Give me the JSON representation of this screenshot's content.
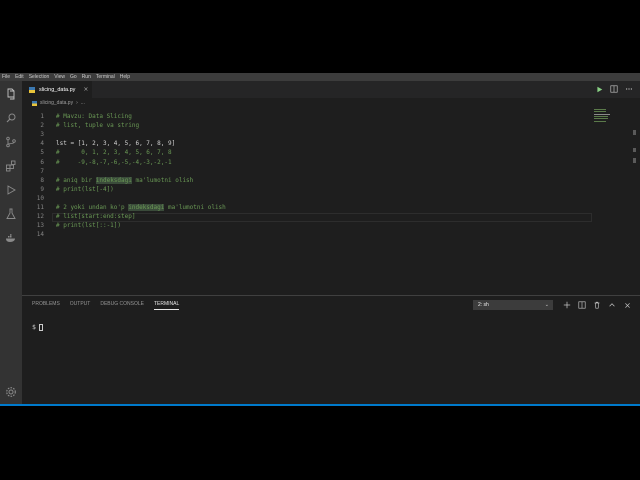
{
  "menu": [
    "File",
    "Edit",
    "Selection",
    "View",
    "Go",
    "Run",
    "Terminal",
    "Help"
  ],
  "tab": {
    "filename": "slicing_data.py",
    "close": "×"
  },
  "breadcrumb": {
    "file": "slicing_data.py",
    "sep": "›",
    "more": "..."
  },
  "code_lines": [
    {
      "n": "1",
      "text": "# Mavzu: Data Slicing",
      "type": "comment"
    },
    {
      "n": "2",
      "text": "# list, tuple va string",
      "type": "comment"
    },
    {
      "n": "3",
      "text": "",
      "type": "blank"
    },
    {
      "n": "4",
      "text": "lst = [1, 2, 3, 4, 5, 6, 7, 8, 9]",
      "type": "code"
    },
    {
      "n": "5",
      "text": "#      0, 1, 2, 3, 4, 5, 6, 7, 8",
      "type": "comment"
    },
    {
      "n": "6",
      "text": "#     -9,-8,-7,-6,-5,-4,-3,-2,-1",
      "type": "comment"
    },
    {
      "n": "7",
      "text": "",
      "type": "blank"
    },
    {
      "n": "8",
      "pre": "# aniq bir ",
      "hl": "indeksdagi",
      "post": " ma'lumotni olish",
      "type": "highlight"
    },
    {
      "n": "9",
      "text": "# print(lst[-4])",
      "type": "comment"
    },
    {
      "n": "10",
      "text": "",
      "type": "blank"
    },
    {
      "n": "11",
      "pre": "# 2 yoki undan ko'p ",
      "hl": "indeksdagi",
      "post": " ma'lumotni olish",
      "type": "highlight"
    },
    {
      "n": "12",
      "text": "# list[start:end:step]",
      "type": "comment"
    },
    {
      "n": "13",
      "text": "# print(lst[::-1])",
      "type": "comment"
    },
    {
      "n": "14",
      "text": "",
      "type": "blank"
    }
  ],
  "panel": {
    "tabs": [
      "PROBLEMS",
      "OUTPUT",
      "DEBUG CONSOLE",
      "TERMINAL"
    ],
    "active": "TERMINAL",
    "terminal_select": "2: sh",
    "prompt": "$"
  },
  "colors": {
    "editor_bg": "#1e1e1e",
    "activity_bg": "#333333",
    "comment": "#6a9955",
    "status": "#007acc"
  }
}
